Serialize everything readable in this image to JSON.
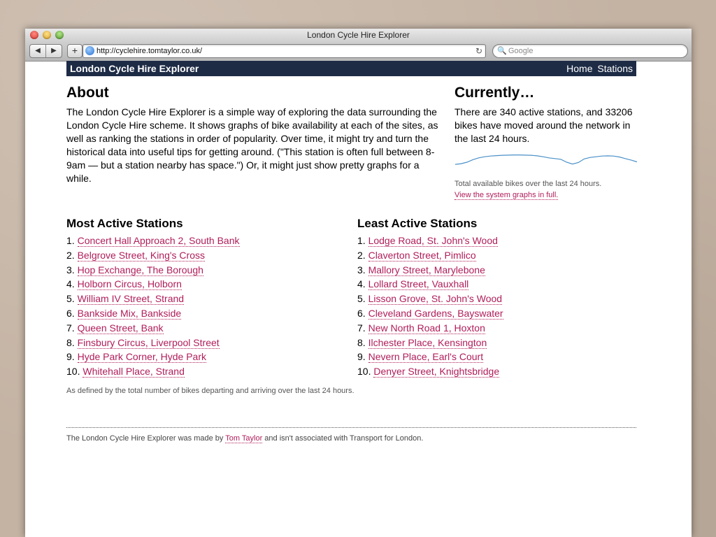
{
  "browser": {
    "window_title": "London Cycle Hire Explorer",
    "back_glyph": "◀",
    "forward_glyph": "▶",
    "add_glyph": "+",
    "url": "http://cyclehire.tomtaylor.co.uk/",
    "reload_glyph": "↻",
    "search_glyph": "🔍",
    "search_placeholder": "Google"
  },
  "header": {
    "brand": "London Cycle Hire Explorer",
    "nav": [
      "Home",
      "Stations"
    ]
  },
  "about": {
    "heading": "About",
    "text": "The London Cycle Hire Explorer is a simple way of exploring the data surrounding the London Cycle Hire scheme. It shows graphs of bike availability at each of the sites, as well as ranking the stations in order of popularity. Over time, it might try and turn the historical data into useful tips for getting around. (\"This station is often full between 8-9am — but a station nearby has space.\") Or, it might just show pretty graphs for a while."
  },
  "currently": {
    "heading": "Currently…",
    "text": "There are 340 active stations, and 33206 bikes have moved around the network in the last 24 hours.",
    "caption": "Total available bikes over the last 24 hours.",
    "link": "View the system graphs in full.",
    "line_color": "#4a90c8",
    "sparkline": [
      0.62,
      0.58,
      0.5,
      0.36,
      0.26,
      0.2,
      0.16,
      0.14,
      0.12,
      0.11,
      0.1,
      0.1,
      0.11,
      0.12,
      0.15,
      0.2,
      0.26,
      0.3,
      0.34,
      0.5,
      0.6,
      0.52,
      0.32,
      0.24,
      0.2,
      0.16,
      0.15,
      0.16,
      0.21,
      0.3,
      0.38,
      0.48
    ]
  },
  "most_active": {
    "heading": "Most Active Stations",
    "items": [
      {
        "rank": "1.",
        "name": "Concert Hall Approach 2, South Bank"
      },
      {
        "rank": "2.",
        "name": "Belgrove Street, King's Cross"
      },
      {
        "rank": "3.",
        "name": "Hop Exchange, The Borough"
      },
      {
        "rank": "4.",
        "name": "Holborn Circus, Holborn"
      },
      {
        "rank": "5.",
        "name": "William IV Street, Strand"
      },
      {
        "rank": "6.",
        "name": "Bankside Mix, Bankside"
      },
      {
        "rank": "7.",
        "name": "Queen Street, Bank"
      },
      {
        "rank": "8.",
        "name": "Finsbury Circus, Liverpool Street"
      },
      {
        "rank": "9.",
        "name": "Hyde Park Corner, Hyde Park"
      },
      {
        "rank": "10.",
        "name": "Whitehall Place, Strand"
      }
    ]
  },
  "least_active": {
    "heading": "Least Active Stations",
    "items": [
      {
        "rank": "1.",
        "name": "Lodge Road, St. John's Wood"
      },
      {
        "rank": "2.",
        "name": "Claverton Street, Pimlico"
      },
      {
        "rank": "3.",
        "name": "Mallory Street, Marylebone"
      },
      {
        "rank": "4.",
        "name": "Lollard Street, Vauxhall"
      },
      {
        "rank": "5.",
        "name": "Lisson Grove, St. John's Wood"
      },
      {
        "rank": "6.",
        "name": "Cleveland Gardens, Bayswater"
      },
      {
        "rank": "7.",
        "name": "New North Road 1, Hoxton"
      },
      {
        "rank": "8.",
        "name": "Ilchester Place, Kensington"
      },
      {
        "rank": "9.",
        "name": "Nevern Place, Earl's Court"
      },
      {
        "rank": "10.",
        "name": "Denyer Street, Knightsbridge"
      }
    ]
  },
  "footnote": "As defined by the total number of bikes departing and arriving over the last 24 hours.",
  "footer": {
    "before": "The London Cycle Hire Explorer was made by",
    "author": "Tom Taylor",
    "after": "and isn't associated with Transport for London."
  }
}
